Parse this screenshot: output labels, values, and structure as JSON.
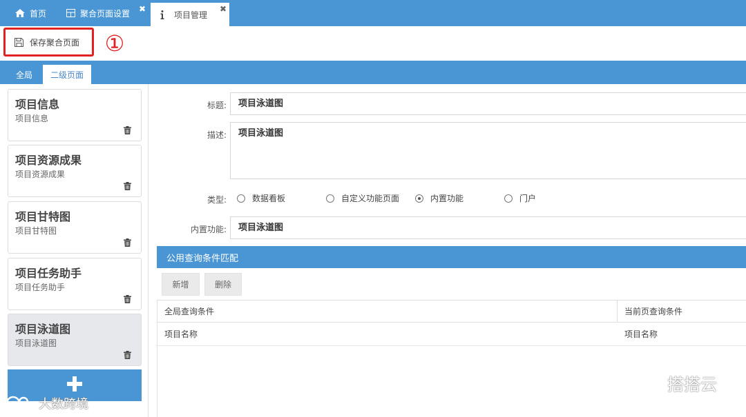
{
  "tabs": {
    "home": "首页",
    "aggregate": "聚合页面设置",
    "project": "项目管理",
    "close_glyph": "✖"
  },
  "toolbar": {
    "save_label": "保存聚合页面",
    "annotation": "①"
  },
  "subtabs": {
    "global": "全局",
    "second_level": "二级页面"
  },
  "cards": [
    {
      "title": "项目信息",
      "subtitle": "项目信息"
    },
    {
      "title": "项目资源成果",
      "subtitle": "项目资源成果"
    },
    {
      "title": "项目甘特图",
      "subtitle": "项目甘特图"
    },
    {
      "title": "项目任务助手",
      "subtitle": "项目任务助手"
    },
    {
      "title": "项目泳道图",
      "subtitle": "项目泳道图"
    }
  ],
  "active_card": 4,
  "form": {
    "title_label": "标题:",
    "title_value": "项目泳道图",
    "desc_label": "描述:",
    "desc_value": "项目泳道图",
    "type_label": "类型:",
    "type_options": [
      "数据看板",
      "自定义功能页面",
      "内置功能",
      "门户"
    ],
    "type_selected": "内置功能",
    "builtin_label": "内置功能:",
    "builtin_value": "项目泳道图"
  },
  "query": {
    "header": "公用查询条件匹配",
    "add_label": "新增",
    "delete_label": "删除",
    "columns": [
      "全局查询条件",
      "当前页查询条件"
    ],
    "rows": [
      [
        "项目名称",
        "项目名称"
      ]
    ]
  },
  "watermarks": {
    "left": "大数跨境",
    "right": "搭搭云"
  },
  "colors": {
    "brand_blue": "#4a96d5",
    "highlight_red": "#e02222"
  }
}
